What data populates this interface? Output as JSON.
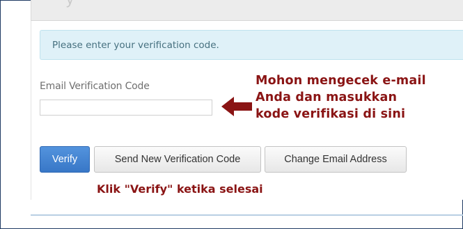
{
  "header": {
    "clipped_title": "y"
  },
  "alert": {
    "message": "Please enter your verification code."
  },
  "form": {
    "field_label": "Email Verification Code",
    "field_value": "",
    "field_placeholder": ""
  },
  "annotation": {
    "line1": "Mohon mengecek e-mail",
    "line2": "Anda dan masukkan",
    "line3": "kode verifikasi di sini",
    "hint": "Klik \"Verify\" ketika selesai",
    "color": "#8a1414"
  },
  "buttons": {
    "verify": "Verify",
    "send_new_code": "Send New Verification Code",
    "change_email": "Change Email Address"
  },
  "colors": {
    "primary_button": "#4a88d4",
    "alert_background": "#dff1f8",
    "alert_text": "#46707f"
  },
  "icons": {
    "annotation_arrow": "left-arrow-icon"
  }
}
